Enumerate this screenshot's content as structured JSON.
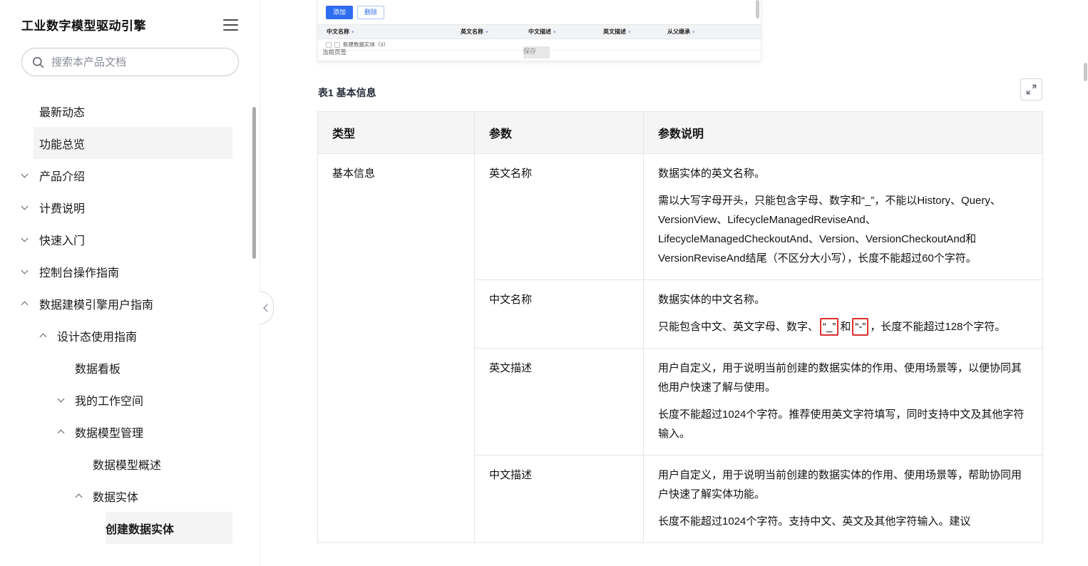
{
  "sidebar": {
    "title": "工业数字模型驱动引擎",
    "search": {
      "placeholder": "搜索本产品文档"
    },
    "items": [
      {
        "label": "最新动态"
      },
      {
        "label": "功能总览"
      },
      {
        "label": "产品介绍"
      },
      {
        "label": "计费说明"
      },
      {
        "label": "快速入门"
      },
      {
        "label": "控制台操作指南"
      },
      {
        "label": "数据建模引擎用户指南"
      },
      {
        "label": "设计态使用指南"
      },
      {
        "label": "数据看板"
      },
      {
        "label": "我的工作空间"
      },
      {
        "label": "数据模型管理"
      },
      {
        "label": "数据模型概述"
      },
      {
        "label": "数据实体"
      },
      {
        "label": "创建数据实体"
      }
    ]
  },
  "screenshot": {
    "toolbar": {
      "add": "添加",
      "delete": "删除"
    },
    "columns": [
      "中文名称",
      "英文名称",
      "中文描述",
      "英文描述",
      "从父继承"
    ],
    "filter_glyph": "▾",
    "row_label": "新建数据实体（3）",
    "footer": {
      "page_label": "当前页签",
      "save": "保存"
    }
  },
  "content": {
    "table_caption": "表1 基本信息",
    "table": {
      "headers": [
        "类型",
        "参数",
        "参数说明"
      ],
      "rows": [
        {
          "type": "基本信息",
          "param": "英文名称",
          "p1": "数据实体的英文名称。",
          "p2": "需以大写字母开头，只能包含字母、数字和“_”，不能以History、Query、VersionView、LifecycleManagedReviseAnd、LifecycleManagedCheckoutAnd、Version、VersionCheckoutAnd和VersionReviseAnd结尾（不区分大小写），长度不能超过60个字符。"
        },
        {
          "param": "中文名称",
          "p1": "数据实体的中文名称。",
          "p2_before": "只能包含中文、英文字母、数字、",
          "p2_box1": "“_”",
          "p2_mid": "和",
          "p2_box2": "“-”",
          "p2_after": "，长度不能超过128个字符。"
        },
        {
          "param": "英文描述",
          "p1": "用户自定义，用于说明当前创建的数据实体的作用、使用场景等，以便协同其他用户快速了解与使用。",
          "p2": "长度不能超过1024个字符。推荐使用英文字符填写，同时支持中文及其他字符输入。"
        },
        {
          "param": "中文描述",
          "p1": "用户自定义，用于说明当前创建的数据实体的作用、使用场景等，帮助协同用户快速了解实体功能。",
          "p2": "长度不能超过1024个字符。支持中文、英文及其他字符输入。建议"
        }
      ]
    }
  }
}
